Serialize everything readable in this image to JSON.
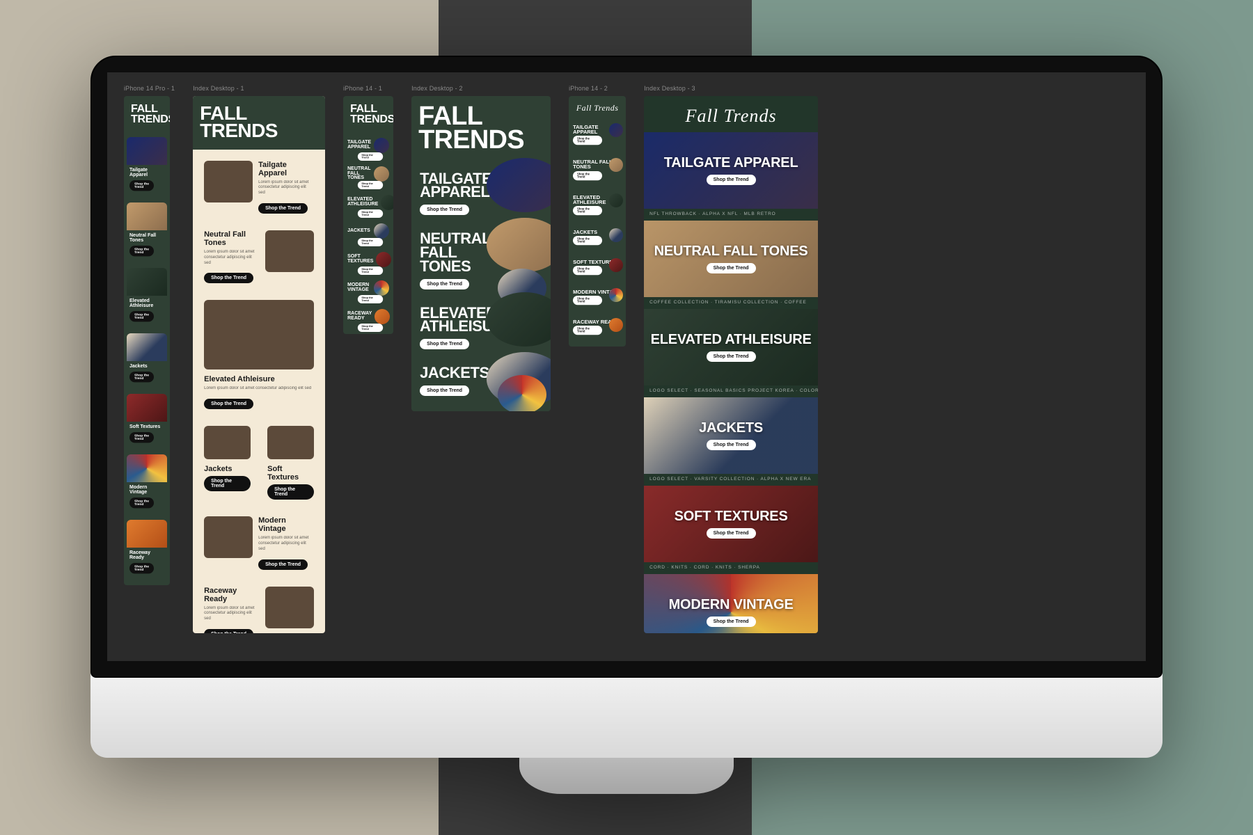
{
  "campaign_title": "FALL TRENDS",
  "campaign_title_serif": "Fall Trends",
  "cta": "Shop the Trend",
  "lorem": "Lorem ipsum dolor sit amet consectetur adipiscing elit sed",
  "trends": [
    {
      "name": "Tailgate Apparel",
      "name_upper": "TAILGATE APPAREL",
      "ph": "ph-navy"
    },
    {
      "name": "Neutral Fall Tones",
      "name_upper": "NEUTRAL FALL TONES",
      "ph": "ph-tan"
    },
    {
      "name": "Elevated Athleisure",
      "name_upper": "ELEVATED ATHLEISURE",
      "ph": "ph-green"
    },
    {
      "name": "Jackets",
      "name_upper": "JACKETS",
      "ph": "ph-varsit"
    },
    {
      "name": "Soft Textures",
      "name_upper": "SOFT TEXTURES",
      "ph": "ph-red"
    },
    {
      "name": "Modern Vintage",
      "name_upper": "MODERN VINTAGE",
      "ph": "ph-mix"
    },
    {
      "name": "Raceway Ready",
      "name_upper": "RACEWAY READY",
      "ph": "ph-orange"
    }
  ],
  "frames": [
    {
      "label": "iPhone 14 Pro - 1"
    },
    {
      "label": "Index Desktop - 1"
    },
    {
      "label": "iPhone 14 - 1"
    },
    {
      "label": "Index Desktop - 2"
    },
    {
      "label": "iPhone 14 - 2"
    },
    {
      "label": "Index Desktop - 3"
    }
  ],
  "strips": [
    "NFL THROWBACK · ALPHA X NFL · MLB RETRO",
    "COFFEE COLLECTION · TIRAMISU COLLECTION · COFFEE",
    "LOGO SELECT · SEASONAL BASICS PROJECT KOREA · COLORS",
    "LOGO SELECT · VARSITY COLLECTION · ALPHA X NEW ERA",
    "CORD · KNITS · CORD · KNITS · SHERPA"
  ]
}
